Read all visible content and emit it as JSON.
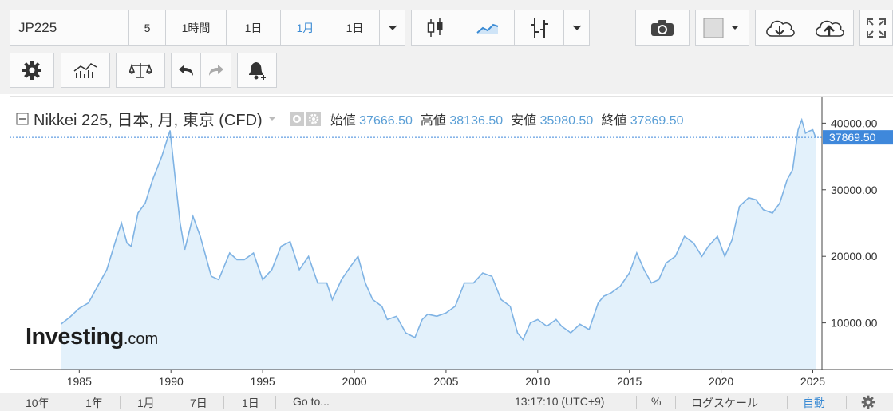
{
  "toolbar1": {
    "symbol": "JP225",
    "intervals": [
      "5",
      "1時間",
      "1日",
      "1月",
      "1日"
    ],
    "selected_interval": "1月"
  },
  "toolbar2": {},
  "legend": {
    "title": "Nikkei 225, 日本, 月, 東京 (CFD)",
    "open_label": "始値",
    "open": "37666.50",
    "high_label": "高値",
    "high": "38136.50",
    "low_label": "安値",
    "low": "35980.50",
    "close_label": "終値",
    "close": "37869.50"
  },
  "watermark": {
    "brand": "Investing",
    "suffix": ".com"
  },
  "bottom_bar": {
    "ranges": [
      "10年",
      "1年",
      "1月",
      "7日",
      "1日"
    ],
    "goto": "Go to...",
    "time": "13:17:10 (UTC+9)",
    "percent": "%",
    "log_scale": "ログスケール",
    "auto": "自動"
  },
  "colors": {
    "line": "#7fb3e4",
    "fill": "#e3f1fb",
    "accent": "#3b8bd4",
    "price_tag": "#3f88db"
  },
  "chart_data": {
    "type": "area",
    "x_ticks": [
      "1985",
      "1990",
      "1995",
      "2000",
      "2005",
      "2010",
      "2015",
      "2020",
      "2025"
    ],
    "y_ticks": [
      "10000.00",
      "20000.00",
      "30000.00",
      "40000.00"
    ],
    "ylim": [
      3000,
      44000
    ],
    "xlim": [
      1981.2,
      2025.5
    ],
    "last_price": "37869.50",
    "x": [
      1984.0,
      1984.5,
      1985.0,
      1985.5,
      1986.0,
      1986.5,
      1987.0,
      1987.3,
      1987.6,
      1987.83,
      1988.2,
      1988.6,
      1989.0,
      1989.5,
      1989.95,
      1990.3,
      1990.5,
      1990.75,
      1991.2,
      1991.6,
      1992.2,
      1992.6,
      1993.2,
      1993.6,
      1994.0,
      1994.5,
      1995.0,
      1995.5,
      1996.0,
      1996.5,
      1997.0,
      1997.5,
      1998.0,
      1998.5,
      1998.8,
      1999.3,
      1999.8,
      2000.2,
      2000.6,
      2001.0,
      2001.5,
      2001.8,
      2002.3,
      2002.8,
      2003.3,
      2003.7,
      2004.0,
      2004.5,
      2005.0,
      2005.5,
      2006.0,
      2006.5,
      2007.0,
      2007.5,
      2008.0,
      2008.5,
      2008.9,
      2009.2,
      2009.6,
      2010.0,
      2010.5,
      2011.0,
      2011.3,
      2011.8,
      2012.3,
      2012.8,
      2013.3,
      2013.6,
      2014.0,
      2014.5,
      2015.0,
      2015.4,
      2015.8,
      2016.2,
      2016.6,
      2017.0,
      2017.5,
      2018.0,
      2018.5,
      2018.95,
      2019.3,
      2019.8,
      2020.2,
      2020.6,
      2021.0,
      2021.5,
      2021.9,
      2022.3,
      2022.8,
      2023.2,
      2023.6,
      2023.9,
      2024.2,
      2024.4,
      2024.6,
      2024.8,
      2025.0,
      2025.15
    ],
    "values": [
      9800,
      10900,
      12200,
      13000,
      15500,
      18000,
      22500,
      25000,
      22000,
      21500,
      26500,
      28000,
      31500,
      35000,
      38900,
      30000,
      25000,
      21000,
      26000,
      23000,
      17000,
      16500,
      20500,
      19500,
      19500,
      20500,
      16500,
      18000,
      21500,
      22200,
      18000,
      20000,
      16000,
      16000,
      13500,
      16500,
      18500,
      20000,
      16000,
      13500,
      12500,
      10500,
      11000,
      8500,
      7800,
      10500,
      11300,
      11000,
      11500,
      12500,
      16000,
      16000,
      17500,
      17000,
      13500,
      12500,
      8500,
      7500,
      10000,
      10500,
      9500,
      10500,
      9500,
      8500,
      9800,
      9000,
      13000,
      14000,
      14500,
      15500,
      17500,
      20500,
      18000,
      16000,
      16500,
      19000,
      20000,
      23000,
      22000,
      20000,
      21500,
      23000,
      20000,
      22500,
      27500,
      28800,
      28500,
      27000,
      26500,
      28000,
      31500,
      33000,
      39000,
      40500,
      38500,
      38800,
      39000,
      37869.5
    ]
  }
}
